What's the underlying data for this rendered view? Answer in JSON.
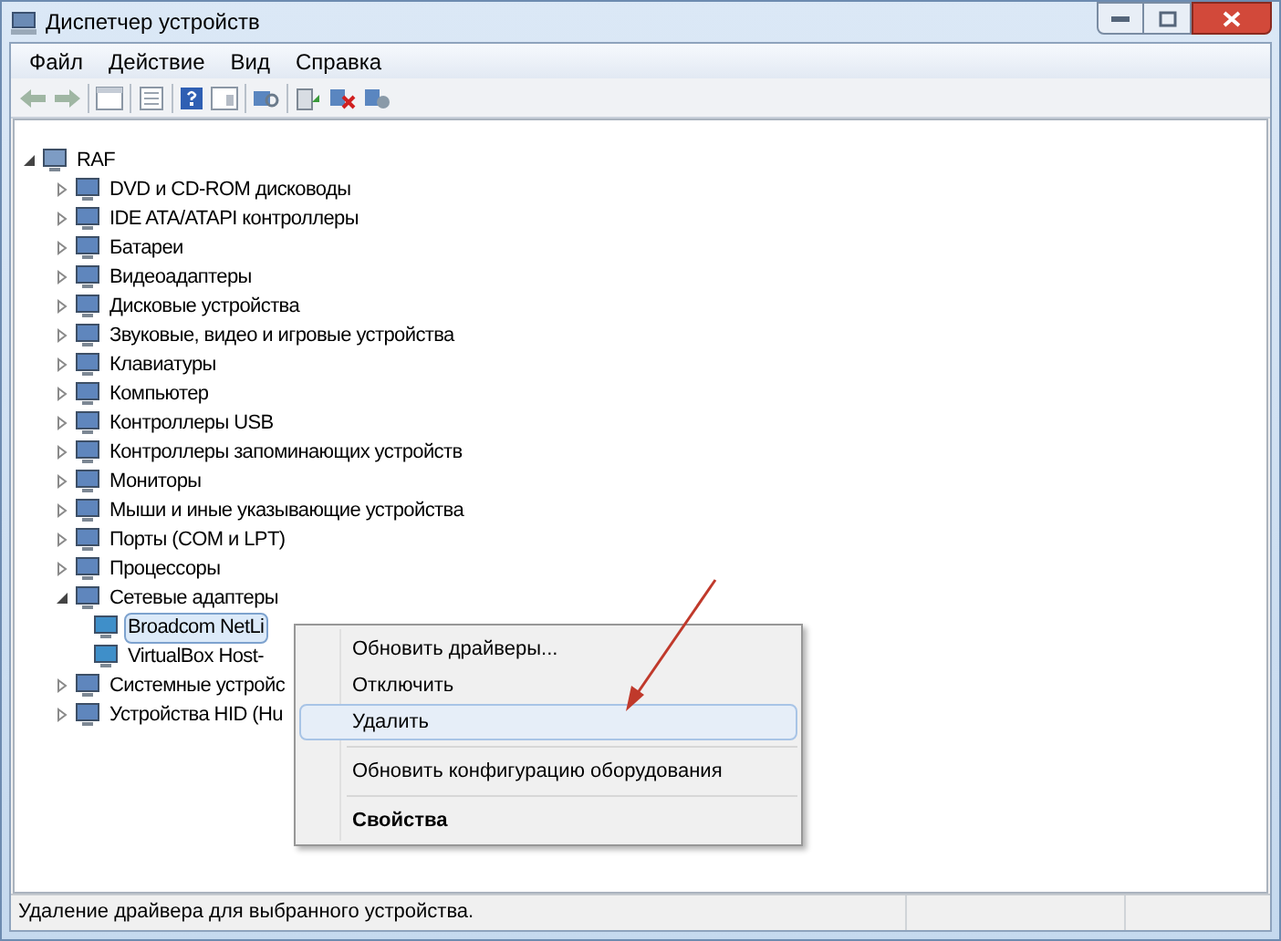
{
  "window": {
    "title": "Диспетчер устройств"
  },
  "menu": [
    "Файл",
    "Действие",
    "Вид",
    "Справка"
  ],
  "tree": {
    "label": "RAF",
    "expanded": true,
    "children": [
      {
        "label": "DVD и CD-ROM дисководы",
        "expanded": false,
        "selected": false
      },
      {
        "label": "IDE ATA/ATAPI контроллеры",
        "expanded": false,
        "selected": false
      },
      {
        "label": "Батареи",
        "expanded": false,
        "selected": false
      },
      {
        "label": "Видеоадаптеры",
        "expanded": false,
        "selected": false
      },
      {
        "label": "Дисковые устройства",
        "expanded": false,
        "selected": false
      },
      {
        "label": "Звуковые, видео и игровые устройства",
        "expanded": false,
        "selected": false
      },
      {
        "label": "Клавиатуры",
        "expanded": false,
        "selected": false
      },
      {
        "label": "Компьютер",
        "expanded": false,
        "selected": false
      },
      {
        "label": "Контроллеры USB",
        "expanded": false,
        "selected": false
      },
      {
        "label": "Контроллеры запоминающих устройств",
        "expanded": false,
        "selected": false
      },
      {
        "label": "Мониторы",
        "expanded": false,
        "selected": false
      },
      {
        "label": "Мыши и иные указывающие устройства",
        "expanded": false,
        "selected": false
      },
      {
        "label": "Порты (COM и LPT)",
        "expanded": false,
        "selected": false
      },
      {
        "label": "Процессоры",
        "expanded": false,
        "selected": false
      },
      {
        "label": "Сетевые адаптеры",
        "expanded": true,
        "selected": false,
        "children": [
          {
            "label": "Broadcom NetLi",
            "selected": true
          },
          {
            "label": "VirtualBox Host-",
            "selected": false
          }
        ]
      },
      {
        "label": "Системные устройс",
        "expanded": false,
        "selected": false
      },
      {
        "label": "Устройства HID (Hu",
        "expanded": false,
        "selected": false
      }
    ]
  },
  "context_menu": [
    {
      "kind": "item",
      "label": "Обновить драйверы...",
      "selected": false
    },
    {
      "kind": "item",
      "label": "Отключить",
      "selected": false
    },
    {
      "kind": "item",
      "label": "Удалить",
      "selected": true
    },
    {
      "kind": "separator"
    },
    {
      "kind": "item",
      "label": "Обновить конфигурацию оборудования",
      "selected": false
    },
    {
      "kind": "separator"
    },
    {
      "kind": "default",
      "label": "Свойства",
      "selected": false
    }
  ],
  "status_bar": "Удаление драйвера для выбранного устройства."
}
